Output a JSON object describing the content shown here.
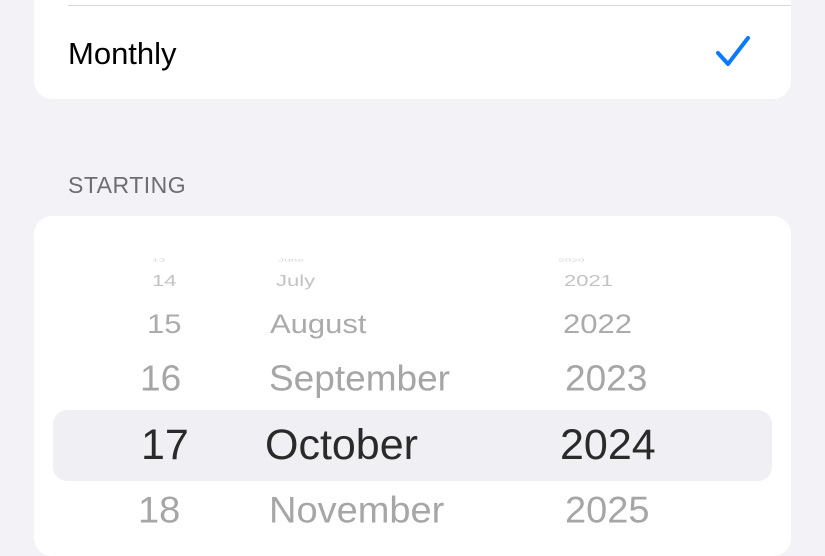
{
  "repeat": {
    "selected_option": "Monthly",
    "check_icon": "checkmark-icon",
    "accent": "#0a7aff"
  },
  "section_label": "STARTING",
  "picker": {
    "days": [
      "13",
      "14",
      "15",
      "16",
      "17",
      "18"
    ],
    "months": [
      "June",
      "July",
      "August",
      "September",
      "October",
      "November"
    ],
    "years": [
      "2020",
      "2021",
      "2022",
      "2023",
      "2024",
      "2025"
    ],
    "selected": {
      "day": "17",
      "month": "October",
      "year": "2024"
    }
  }
}
